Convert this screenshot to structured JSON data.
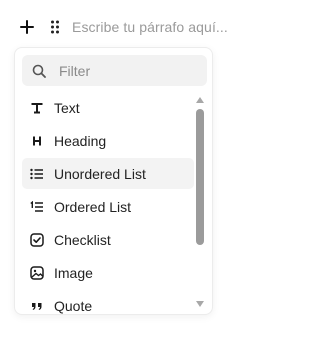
{
  "editor": {
    "add_icon": "plus-icon",
    "drag_icon": "drag-handle-icon",
    "placeholder": "Escribe tu párrafo aquí..."
  },
  "menu": {
    "filter": {
      "placeholder": "Filter",
      "value": "",
      "icon": "search-icon"
    },
    "items": [
      {
        "label": "Text",
        "icon": "text-type-icon"
      },
      {
        "label": "Heading",
        "icon": "heading-icon"
      },
      {
        "label": "Unordered List",
        "icon": "unordered-list-icon"
      },
      {
        "label": "Ordered List",
        "icon": "ordered-list-icon"
      },
      {
        "label": "Checklist",
        "icon": "checklist-icon"
      },
      {
        "label": "Image",
        "icon": "image-icon"
      },
      {
        "label": "Quote",
        "icon": "quote-icon"
      }
    ],
    "highlighted_item": "Unordered List"
  },
  "colors": {
    "highlight_bg": "#f3f3f3",
    "filter_bg": "#f2f2f2",
    "text": "#222222",
    "placeholder_text": "#9a9a9a",
    "scrollbar": "#9b9b9b"
  }
}
